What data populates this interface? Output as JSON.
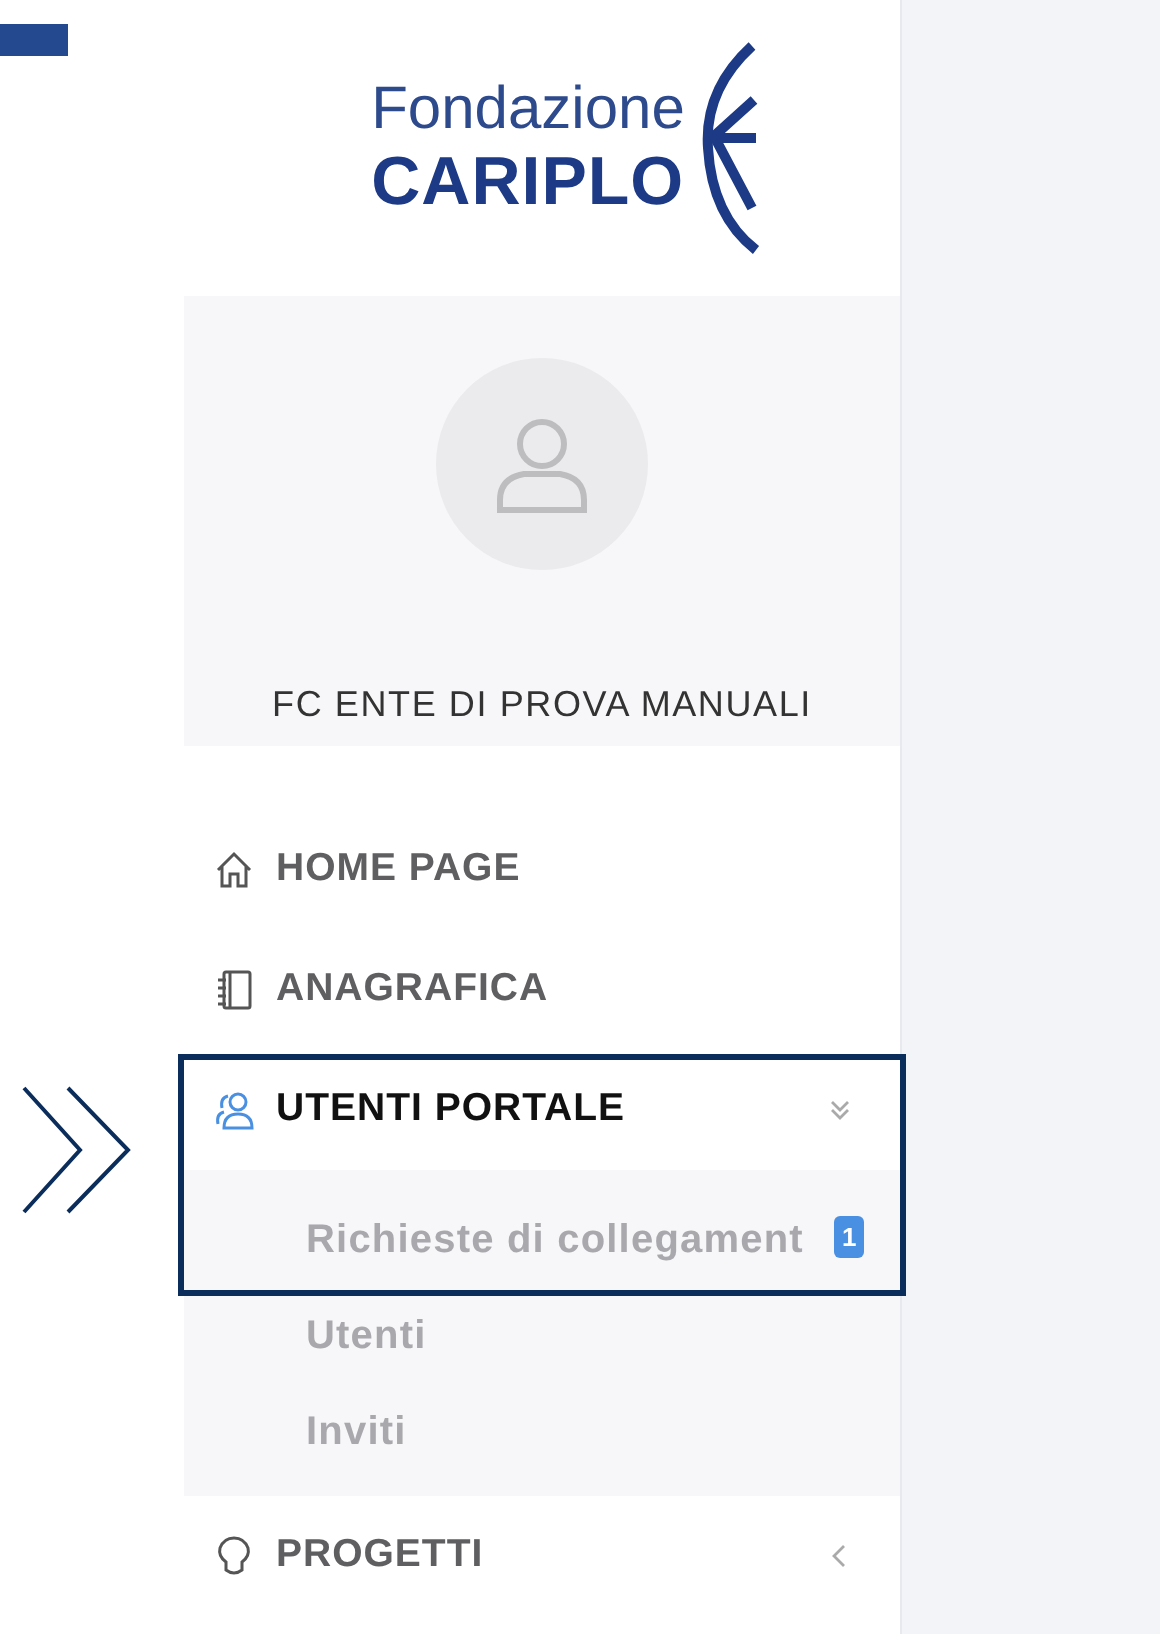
{
  "logo": {
    "line1": "Fondazione",
    "line2": "CARIPLO"
  },
  "profile": {
    "name": "FC ENTE DI PROVA MANUALI"
  },
  "menu": [
    {
      "label": "HOME PAGE",
      "active": false,
      "highlighted": false
    },
    {
      "label": "ANAGRAFICA",
      "active": false,
      "highlighted": false
    },
    {
      "label": "UTENTI PORTALE",
      "active": true,
      "expanded": true,
      "highlighted": true,
      "children": [
        {
          "label": "Richieste di collegament",
          "badge": "1"
        },
        {
          "label": "Utenti"
        },
        {
          "label": "Inviti"
        }
      ]
    },
    {
      "label": "PROGETTI",
      "active": false,
      "expanded": false,
      "highlighted": false
    }
  ]
}
